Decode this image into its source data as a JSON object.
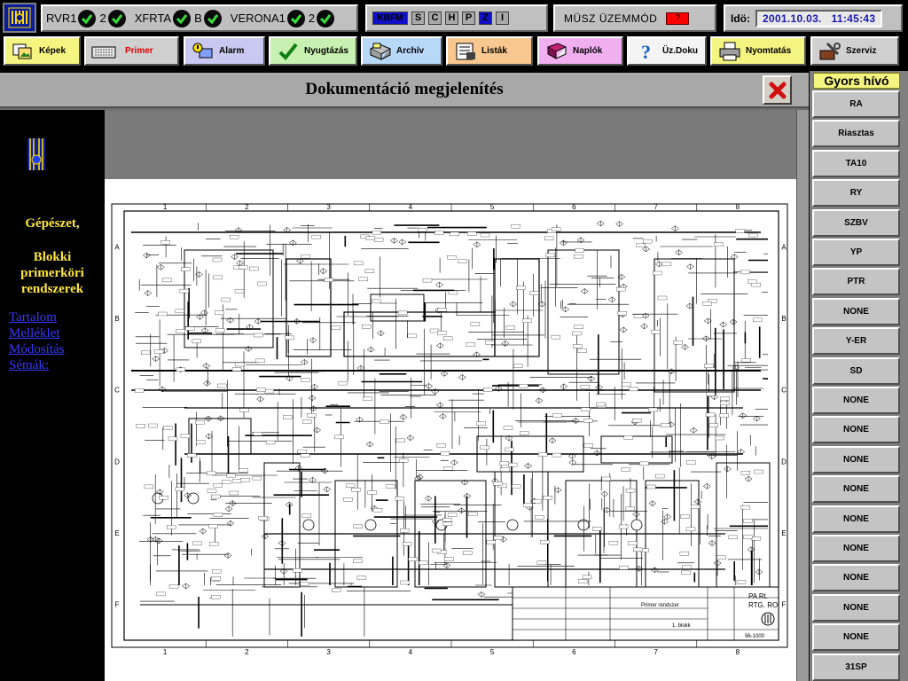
{
  "status": {
    "groups": [
      {
        "label": "RVR1",
        "value": "2"
      },
      {
        "label": "XFRTA",
        "value": "B"
      },
      {
        "label": "VERONA1",
        "value": "2"
      }
    ],
    "modes": [
      "KBFM",
      "S",
      "C",
      "H",
      "P",
      "Z",
      "I"
    ],
    "musz_label": "MÜSZ ÜZEMMÓD",
    "musz_flag": "?",
    "ido_label": "Idö:",
    "ido_value": "2001.10.03.   11:45:43"
  },
  "nav": [
    {
      "label": "Képek",
      "icon": "pictures-icon",
      "color": "#f4f480"
    },
    {
      "label": "Primer",
      "icon": "keyboard-icon",
      "color": "#d0d0d0"
    },
    {
      "label": "Alarm",
      "icon": "alarm-icon",
      "color": "#c8c8f0"
    },
    {
      "label": "Nyugtázás",
      "icon": "acknowledge-check-icon",
      "color": "#c8f0b0"
    },
    {
      "label": "Archív",
      "icon": "archive-icon",
      "color": "#b8d8f8"
    },
    {
      "label": "Listák",
      "icon": "lists-icon",
      "color": "#f8c890"
    },
    {
      "label": "Naplók",
      "icon": "logbook-icon",
      "color": "#f0b0f0"
    },
    {
      "label": "Üz.Doku",
      "icon": "help-question-icon",
      "color": "#f4f4f4"
    },
    {
      "label": "Nyomtatás",
      "icon": "printer-icon",
      "color": "#f4f480"
    },
    {
      "label": "Szerviz",
      "icon": "service-icon",
      "color": "#d0d0d0"
    }
  ],
  "doc": {
    "title": "Dokumentáció megjelenítés",
    "left_heading": [
      "Gépészet,",
      "Blokki",
      "primerköri",
      "rendszerek"
    ],
    "links": [
      "Tartalom",
      "Melléklet",
      "Módosítás",
      "Sémák:"
    ]
  },
  "quick": {
    "title": "Gyors hívó",
    "buttons": [
      "RA",
      "Riasztas",
      "TA10",
      "RY",
      "SZBV",
      "YP",
      "PTR",
      "NONE",
      "Y-ER",
      "SD",
      "NONE",
      "NONE",
      "NONE",
      "NONE",
      "NONE",
      "NONE",
      "NONE",
      "NONE",
      "NONE",
      "31SP"
    ]
  },
  "schematic": {
    "columns": [
      "1",
      "2",
      "3",
      "4",
      "5",
      "6",
      "7",
      "8"
    ],
    "rows": [
      "A",
      "B",
      "C",
      "D",
      "E",
      "F"
    ],
    "titleblock": {
      "company": "PA Rt.",
      "code": "RTG. RO",
      "sheet": "1. blokk",
      "drawing_no": "96-1000",
      "name": "Primer rendszer"
    }
  },
  "colors": {
    "title_bg": "#a8a8a8",
    "quick_title_bg": "#f4f480",
    "left_text": "#ffe63c",
    "link": "#3a3aff",
    "date_text": "#1a1ab0",
    "musz_flag": "#ff0000"
  }
}
